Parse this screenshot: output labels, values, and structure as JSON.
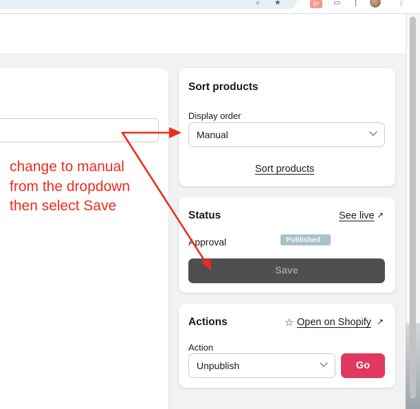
{
  "browser": {
    "ext_badge": "g+"
  },
  "annotation": {
    "lines": [
      "change to manual",
      "from the dropdown",
      "then select Save"
    ],
    "color": "#ee2b1c"
  },
  "sort_card": {
    "title": "Sort products",
    "display_order_label": "Display order",
    "display_order_value": "Manual",
    "sort_link": "Sort products"
  },
  "status_card": {
    "title": "Status",
    "see_live": "See live",
    "approval_label": "Approval",
    "approval_badge": "Published",
    "save_label": "Save"
  },
  "actions_card": {
    "title": "Actions",
    "open_shopify": "Open on Shopify",
    "action_label": "Action",
    "action_value": "Unpublish",
    "go_label": "Go",
    "go_color": "#e0385e"
  },
  "icons": {
    "external": "↗",
    "star": "☆"
  }
}
